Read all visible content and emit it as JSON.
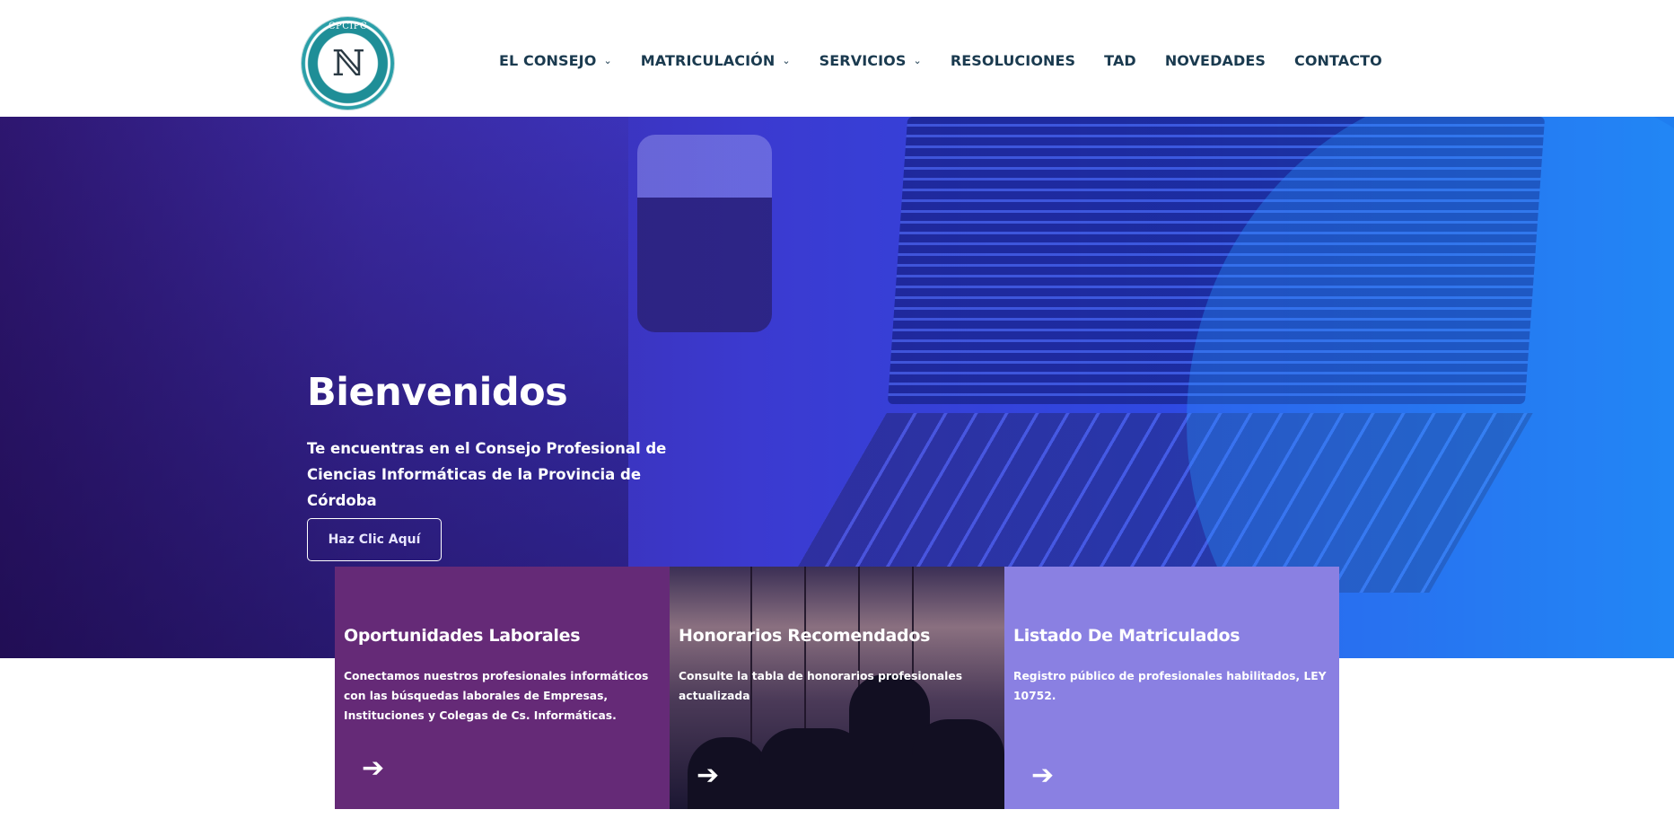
{
  "header": {
    "logo_text": "CPCIPC",
    "nav": [
      {
        "label": "EL CONSEJO",
        "has_dropdown": true
      },
      {
        "label": "MATRICULACIÓN",
        "has_dropdown": true
      },
      {
        "label": "SERVICIOS",
        "has_dropdown": true
      },
      {
        "label": "RESOLUCIONES",
        "has_dropdown": false
      },
      {
        "label": "TAD",
        "has_dropdown": false
      },
      {
        "label": "NOVEDADES",
        "has_dropdown": false
      },
      {
        "label": "CONTACTO",
        "has_dropdown": false
      }
    ]
  },
  "hero": {
    "title": "Bienvenidos",
    "subtitle": "Te encuentras en el Consejo Profesional de Ciencias Informáticas de la Provincia de Córdoba",
    "button_label": "Haz Clic Aquí"
  },
  "cards": [
    {
      "title": "Oportunidades Laborales",
      "description": "Conectamos nuestros profesionales informáticos con las búsquedas laborales de Empresas, Instituciones y Colegas de Cs. Informáticas.",
      "arrow_icon": "arrow-right-icon"
    },
    {
      "title": "Honorarios Recomendados",
      "description": "Consulte la tabla de honorarios profesionales actualizada",
      "arrow_icon": "arrow-right-icon"
    },
    {
      "title": "Listado De Matriculados",
      "description": "Registro público de profesionales habilitados, LEY 10752.",
      "arrow_icon": "arrow-right-icon"
    }
  ],
  "colors": {
    "nav_text": "#1a3a4f",
    "card_purple": "#652a77",
    "card_lavender": "#8a80e2",
    "hero_start": "#2a1266",
    "hero_end": "#1f7ff0"
  }
}
